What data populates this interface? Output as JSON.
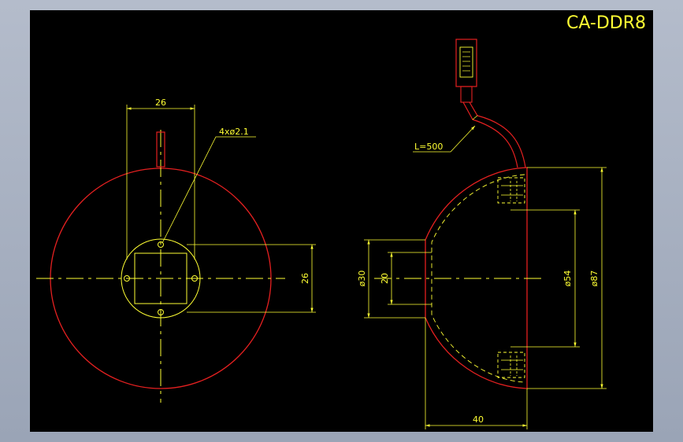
{
  "drawing": {
    "title": "CA-DDR8",
    "colors": {
      "background": "#000000",
      "dimension": "#ffff33",
      "outline": "#e52020",
      "frame": "#b4bccb"
    },
    "front_view": {
      "dim_width": "26",
      "dim_height": "26",
      "hole_callout": "4xø2.1"
    },
    "side_view": {
      "cable_length": "L=500",
      "dim_d30": "ø30",
      "dim_20": "20",
      "dim_d54": "ø54",
      "dim_d87": "ø87",
      "dim_depth": "40"
    }
  }
}
